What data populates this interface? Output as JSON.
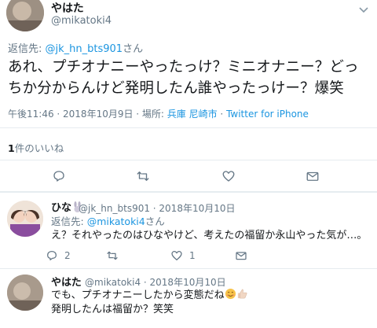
{
  "main_tweet": {
    "display_name": "やはた",
    "handle": "@mikatoki4",
    "reply_prefix": "返信先: ",
    "reply_handle": "@jk_hn_bts901",
    "reply_suffix": "さん",
    "text_line1": "あれ、プチオナニーやったっけ？ミニオナニー？どっ",
    "text_line2": "ちか分からんけど発明したん誰やったっけー？爆笑",
    "time": "午後11:46 · 2018年10月9日 · 場所: ",
    "location": "兵庫 尼崎市",
    "sep": " · ",
    "source": "Twitter for iPhone",
    "likes_count": "1",
    "likes_label": "件のいいね"
  },
  "replies": [
    {
      "display_name": "ひな",
      "handle": "@jk_hn_bts901 · 2018年10月10日",
      "reply_prefix": "返信先: ",
      "reply_handle": "@mikatoki4",
      "reply_suffix": "さん",
      "text": "え？それやったのはひなやけど、考えたの福留か永山やった気が…。",
      "reply_count": "2",
      "like_count": "1"
    },
    {
      "display_name": "やはた",
      "handle": "@mikatoki4 · 2018年10月10日",
      "text_line1": "でも、プチオナニーしたから変態だね",
      "text_line2": "発明したんは福留か？笑笑"
    }
  ],
  "icons": {
    "reply": "reply-icon",
    "retweet": "retweet-icon",
    "like": "heart-icon",
    "message": "envelope-icon",
    "more": "chevron-down-icon"
  },
  "colors": {
    "link": "#1b95e0",
    "secondary": "#657786",
    "divider": "#e6ecf0"
  }
}
